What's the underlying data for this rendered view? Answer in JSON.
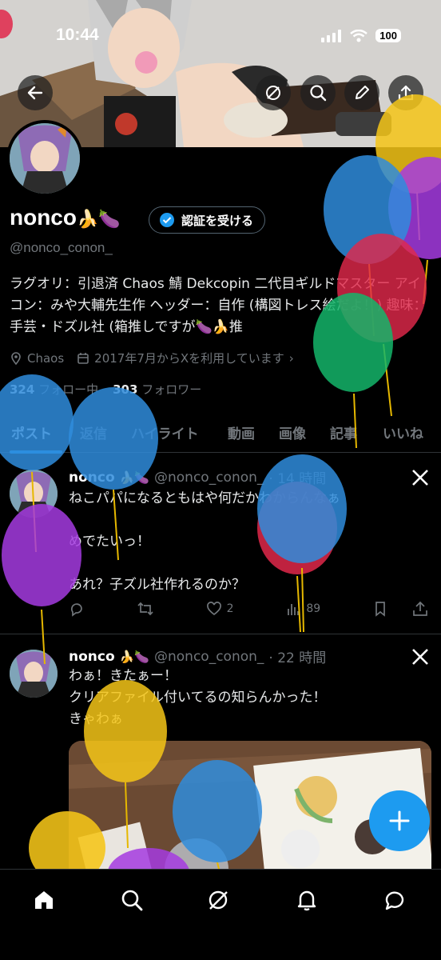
{
  "status": {
    "time": "10:44",
    "battery": "100"
  },
  "profile": {
    "name": "nonco",
    "name_emoji": "🍌🍆",
    "verify_label": "認証を受ける",
    "handle": "@nonco_conon_",
    "bio": "ラグオリ：引退済 Chaos 鯖 Dekcopin 二代目ギルドマスター アイコン：みや大輔先生作 ヘッダー：自作 (構図トレス絵だよ！) 趣味：手芸・ドズル社 (箱推しですが🍆🍌推",
    "location": "Chaos",
    "joined": "2017年7月からXを利用しています",
    "following_count": "324",
    "following_label": "フォロー中",
    "followers_count": "303",
    "followers_label": "フォロワー"
  },
  "tabs": [
    "ポスト",
    "返信",
    "ハイライト",
    "動画",
    "画像",
    "記事",
    "いいね"
  ],
  "tweets": [
    {
      "name": "nonco",
      "emoji": "🍌🍆",
      "handle": "@nonco_conon_",
      "time": "· 14 時間",
      "text": "ねこパパになるともはや何だかわからんなぁ\n\nめでたいっ！\n\nあれ？子ズル社作れるのか？",
      "likes": "2",
      "views": "89"
    },
    {
      "name": "nonco",
      "emoji": "🍌🍆",
      "handle": "@nonco_conon_",
      "time": "· 22 時間",
      "text": "わぁ！きたぁー！\nクリアファイル付いてるの知らんかった！\nきゃわぁ"
    }
  ],
  "colors": {
    "accent": "#1d9bf0",
    "muted": "#71767b",
    "text": "#e7e9ea",
    "divider": "#2f3336"
  }
}
